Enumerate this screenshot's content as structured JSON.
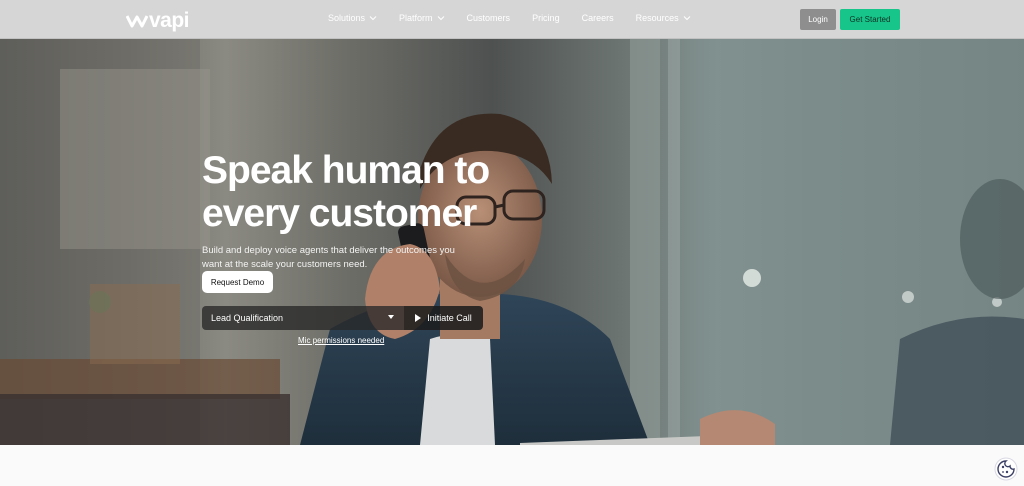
{
  "nav": {
    "logo_text": "vapi",
    "logo_icon": "vapi-wave-icon",
    "menu": [
      {
        "label": "Solutions",
        "has_dropdown": true
      },
      {
        "label": "Platform",
        "has_dropdown": true
      },
      {
        "label": "Customers",
        "has_dropdown": false
      },
      {
        "label": "Pricing",
        "has_dropdown": false
      },
      {
        "label": "Careers",
        "has_dropdown": false
      },
      {
        "label": "Resources",
        "has_dropdown": true
      }
    ],
    "login_label": "Login",
    "get_started_label": "Get Started"
  },
  "hero": {
    "title_line1": "Speak human to",
    "title_line2": "every customer",
    "subtitle": "Build and deploy voice agents that deliver the outcomes you want at the scale your customers need.",
    "demo_label": "Request Demo",
    "select_value": "Lead Qualification",
    "call_label": "Initiate Call",
    "mic_note": "Mic permissions needed"
  },
  "colors": {
    "accent": "#17c58a",
    "nav_bg": "#d6d6d6",
    "login_bg": "#8e8e8e"
  },
  "cookie_icon": "cookie-icon"
}
